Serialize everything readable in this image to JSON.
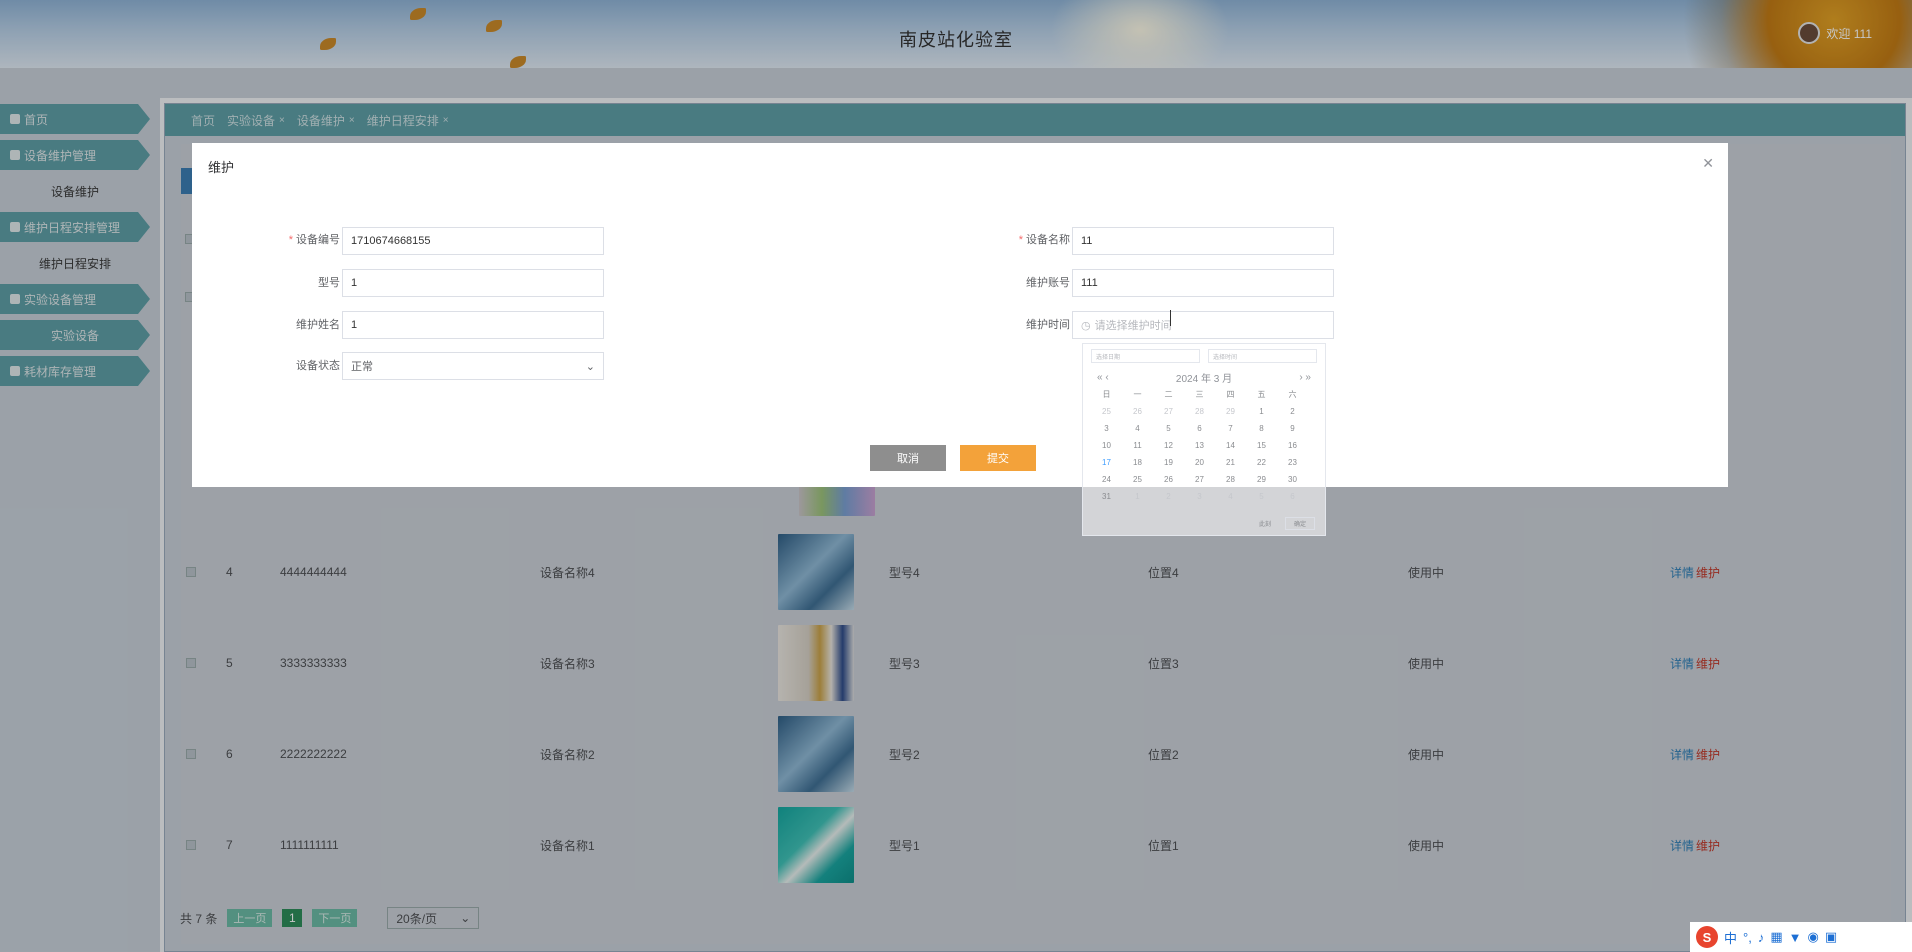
{
  "header": {
    "title": "南皮站化验室",
    "welcome": "欢迎 111"
  },
  "sidebar": {
    "items": [
      {
        "label": "首页",
        "type": "top"
      },
      {
        "label": "设备维护管理",
        "type": "top"
      },
      {
        "label": "设备维护",
        "type": "sub"
      },
      {
        "label": "维护日程安排管理",
        "type": "top"
      },
      {
        "label": "维护日程安排",
        "type": "sub"
      },
      {
        "label": "实验设备管理",
        "type": "top"
      },
      {
        "label": "实验设备",
        "type": "sub-active"
      },
      {
        "label": "耗材库存管理",
        "type": "top"
      }
    ]
  },
  "tabs": [
    "首页",
    "实验设备",
    "设备维护",
    "维护日程安排"
  ],
  "table": {
    "rows": [
      {
        "index": "4",
        "code": "4444444444",
        "name": "设备名称4",
        "model": "型号4",
        "location": "位置4",
        "status": "使用中"
      },
      {
        "index": "5",
        "code": "3333333333",
        "name": "设备名称3",
        "model": "型号3",
        "location": "位置3",
        "status": "使用中"
      },
      {
        "index": "6",
        "code": "2222222222",
        "name": "设备名称2",
        "model": "型号2",
        "location": "位置2",
        "status": "使用中"
      },
      {
        "index": "7",
        "code": "1111111111",
        "name": "设备名称1",
        "model": "型号1",
        "location": "位置1",
        "status": "使用中"
      }
    ],
    "detail_label": "详情",
    "maintain_label": "维护"
  },
  "pager": {
    "total": "共 7 条",
    "prev": "上一页",
    "page": "1",
    "next": "下一页",
    "size": "20条/页"
  },
  "dialog": {
    "title": "维护",
    "fields": {
      "code_label": "设备编号",
      "code_value": "1710674668155",
      "name_label": "设备名称",
      "name_value": "11",
      "model_label": "型号",
      "model_value": "1",
      "account_label": "维护账号",
      "account_value": "111",
      "person_label": "维护姓名",
      "person_value": "1",
      "time_label": "维护时间",
      "time_placeholder": "请选择维护时间",
      "status_label": "设备状态",
      "status_value": "正常"
    },
    "cancel": "取消",
    "submit": "提交"
  },
  "picker": {
    "date_placeholder": "选择日期",
    "time_placeholder": "选择时间",
    "header": "2024 年  3 月",
    "weekdays": [
      "日",
      "一",
      "二",
      "三",
      "四",
      "五",
      "六"
    ],
    "days": [
      "25",
      "26",
      "27",
      "28",
      "29",
      "1",
      "2",
      "3",
      "4",
      "5",
      "6",
      "7",
      "8",
      "9",
      "10",
      "11",
      "12",
      "13",
      "14",
      "15",
      "16",
      "17",
      "18",
      "19",
      "20",
      "21",
      "22",
      "23",
      "24",
      "25",
      "26",
      "27",
      "28",
      "29",
      "30",
      "31",
      "1",
      "2",
      "3",
      "4",
      "5",
      "6"
    ],
    "clear": "此刻",
    "ok": "确定"
  },
  "ime": {
    "lang": "中"
  }
}
